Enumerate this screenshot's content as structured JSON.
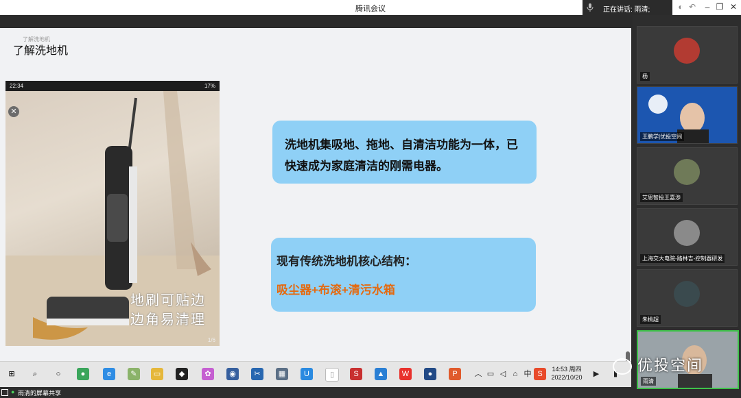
{
  "window": {
    "title": "腾讯会议"
  },
  "speaker": {
    "label": "正在讲话: 雨清;"
  },
  "slide": {
    "heading": "了解洗地机",
    "heading_small": "了解洗地机",
    "phone": {
      "status_time": "22:34",
      "status_right": "17%",
      "overlay_line1": "地刷可贴边",
      "overlay_line2": "边角易清理",
      "pager": "1/6"
    },
    "bubble1_text": "洗地机集吸地、拖地、自清洁功能为一体，已快速成为家庭清洁的刚需电器。",
    "bubble2_title": "现有传统洗地机核心结构：",
    "bubble2_highlight": "吸尘器+布滚+清污水箱",
    "highlight_color": "#e46a10",
    "bubble_color": "#8fd0f6"
  },
  "taskbar": {
    "time": "14:53 周四",
    "date": "2022/10/20"
  },
  "share_label": "雨清的屏幕共享",
  "participants": [
    {
      "name": "杨"
    },
    {
      "name": "王鹏学|优投空间"
    },
    {
      "name": "艾思智投王嘉渉"
    },
    {
      "name": "上海交大电院-路林吉-控制器研发"
    },
    {
      "name": "朱桃超"
    },
    {
      "name": "雨清"
    }
  ],
  "watermark": "优投空间"
}
